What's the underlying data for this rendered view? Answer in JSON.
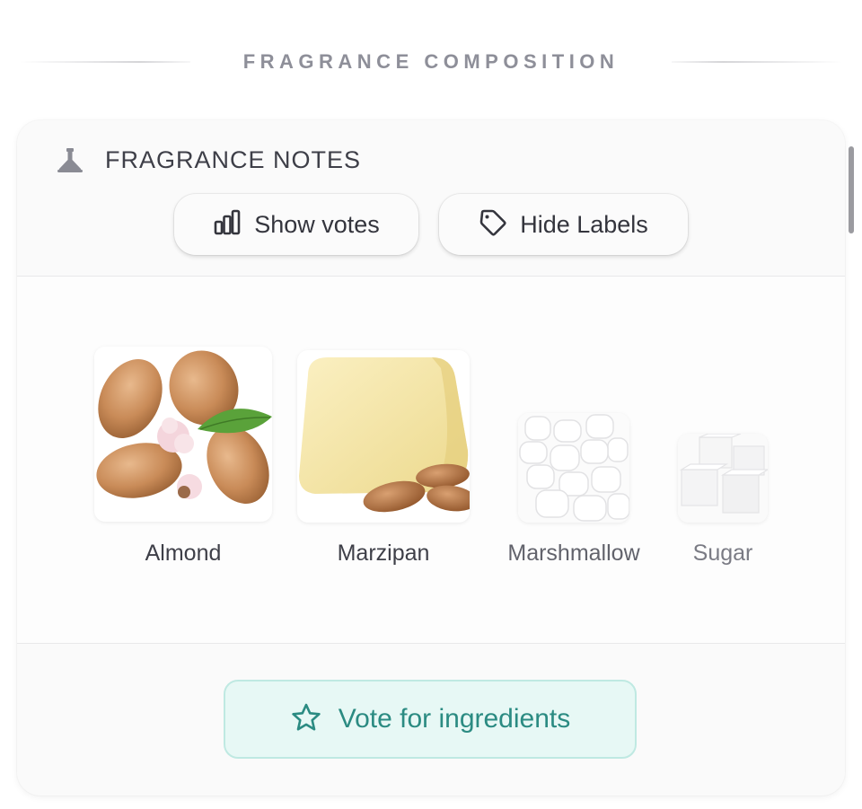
{
  "section": {
    "title": "FRAGRANCE COMPOSITION"
  },
  "card": {
    "title": "FRAGRANCE NOTES",
    "icon": "perfume-bottle-icon",
    "buttons": {
      "show_votes": {
        "label": "Show votes",
        "icon": "bar-chart-icon"
      },
      "hide_labels": {
        "label": "Hide Labels",
        "icon": "tag-icon"
      }
    },
    "notes": [
      {
        "name": "Almond",
        "image": "almond-image"
      },
      {
        "name": "Marzipan",
        "image": "marzipan-image"
      },
      {
        "name": "Marshmallow",
        "image": "marshmallow-image"
      },
      {
        "name": "Sugar",
        "image": "sugar-image"
      }
    ],
    "vote_button": {
      "label": "Vote for ingredients",
      "icon": "star-icon"
    }
  },
  "colors": {
    "accent": "#2b8b82",
    "accent_bg": "#e7f8f5",
    "text_dark": "#3e3f48",
    "text_muted": "#8e8f99"
  }
}
